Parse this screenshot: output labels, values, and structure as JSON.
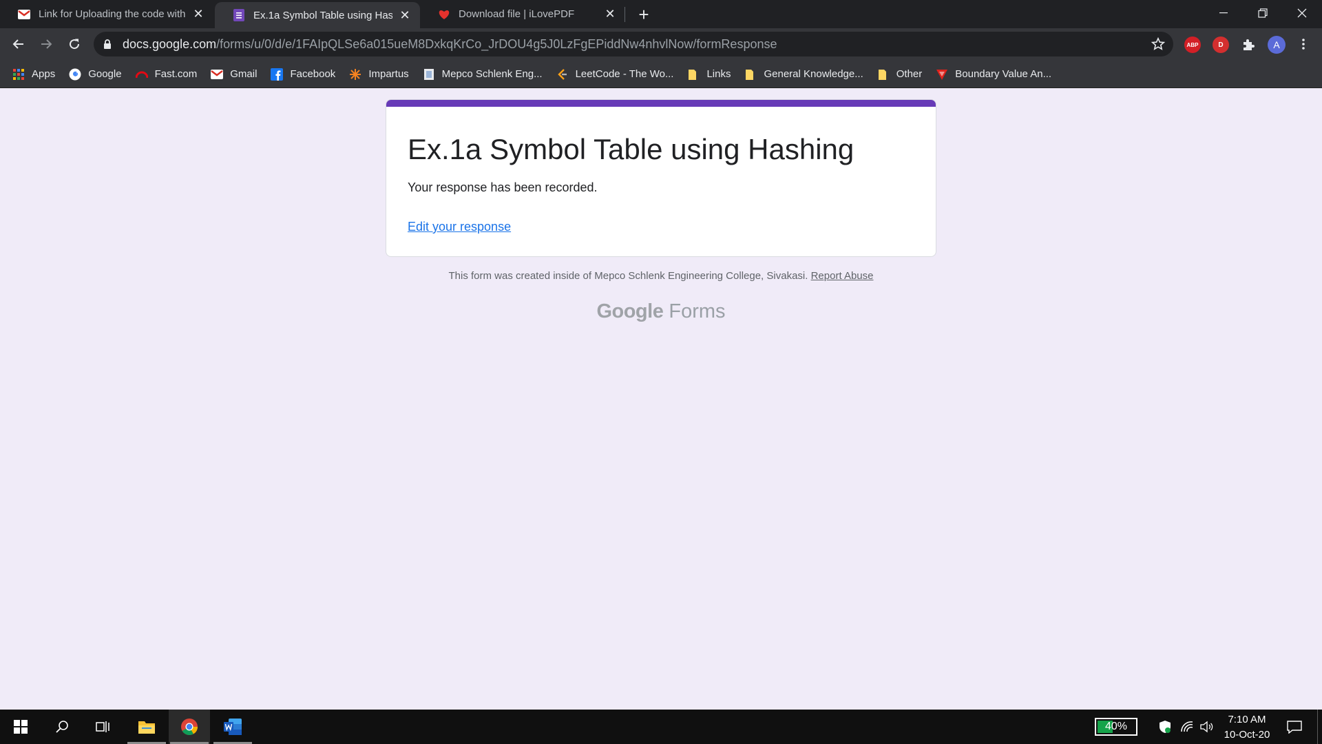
{
  "browser": {
    "tabs": [
      {
        "title": "Link for Uploading the code with",
        "favicon": "gmail-icon"
      },
      {
        "title": "Ex.1a Symbol Table using Hashing",
        "favicon": "google-forms-icon",
        "active": true
      },
      {
        "title": "Download file | iLovePDF",
        "favicon": "ilovepdf-icon"
      }
    ],
    "address": {
      "host": "docs.google.com",
      "path": "/forms/u/0/d/e/1FAIpQLSe6a015ueM8DxkqKrCo_JrDOU4g5J0LzFgEPiddNw4nhvlNow/formResponse"
    },
    "extensions": [
      "ABP",
      "D",
      "A"
    ],
    "bookmarks": [
      {
        "label": "Apps",
        "icon": "apps-grid-icon"
      },
      {
        "label": "Google",
        "icon": "google-icon"
      },
      {
        "label": "Fast.com",
        "icon": "fast-icon"
      },
      {
        "label": "Gmail",
        "icon": "gmail-icon"
      },
      {
        "label": "Facebook",
        "icon": "facebook-icon"
      },
      {
        "label": "Impartus",
        "icon": "impartus-icon"
      },
      {
        "label": "Mepco Schlenk Eng...",
        "icon": "page-icon"
      },
      {
        "label": "LeetCode - The Wo...",
        "icon": "leetcode-icon"
      },
      {
        "label": "Links",
        "icon": "folder-icon"
      },
      {
        "label": "General Knowledge...",
        "icon": "folder-icon"
      },
      {
        "label": "Other",
        "icon": "folder-icon"
      },
      {
        "label": "Boundary Value An...",
        "icon": "shield-icon"
      }
    ]
  },
  "form": {
    "title": "Ex.1a Symbol Table using Hashing",
    "message": "Your response has been recorded.",
    "edit_link": "Edit your response",
    "accent_color": "#673ab7",
    "footer_text": "This form was created inside of Mepco Schlenk Engineering College, Sivakasi.",
    "report_abuse": "Report Abuse",
    "brand_google": "Google",
    "brand_forms": "Forms"
  },
  "taskbar": {
    "battery": "40%",
    "time": "7:10 AM",
    "date": "10-Oct-20"
  }
}
